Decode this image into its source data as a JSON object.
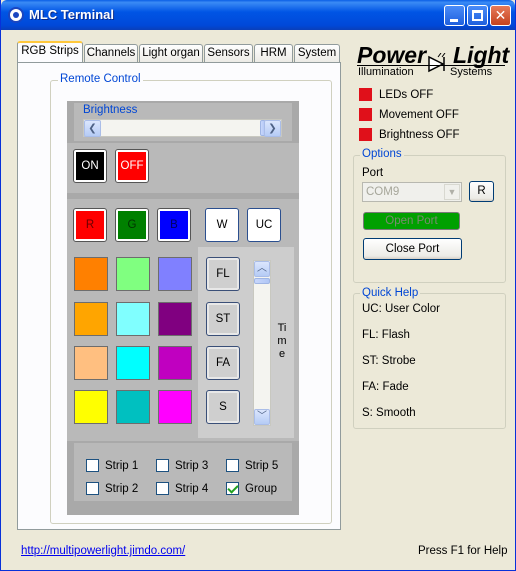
{
  "window": {
    "title": "MLC Terminal"
  },
  "tabs": [
    "RGB Strips",
    "Channels",
    "Light organ",
    "Sensors",
    "HRM",
    "System"
  ],
  "remote_control": {
    "label": "Remote Control",
    "brightness_label": "Brightness",
    "on_label": "ON",
    "off_label": "OFF",
    "rgb_buttons": [
      {
        "label": "R",
        "color": "#ff0000"
      },
      {
        "label": "G",
        "color": "#008000"
      },
      {
        "label": "B",
        "color": "#0000ff"
      }
    ],
    "w_label": "W",
    "uc_label": "UC",
    "palette": [
      [
        "#ff8000",
        "#80ff80",
        "#8080ff"
      ],
      [
        "#ffa500",
        "#80ffff",
        "#800080"
      ],
      [
        "#ffbf80",
        "#00ffff",
        "#c000c0"
      ],
      [
        "#ffff00",
        "#00c0c0",
        "#ff00ff"
      ]
    ],
    "effect_buttons": [
      "FL",
      "ST",
      "FA",
      "S"
    ],
    "time_label": "Time",
    "strips": [
      {
        "label": "Strip 1",
        "checked": false
      },
      {
        "label": "Strip 3",
        "checked": false
      },
      {
        "label": "Strip 5",
        "checked": false
      },
      {
        "label": "Strip 2",
        "checked": false
      },
      {
        "label": "Strip 4",
        "checked": false
      },
      {
        "label": "Group",
        "checked": true
      }
    ]
  },
  "logo": {
    "power": "Power",
    "light": "Light",
    "sub_left": "Illumination",
    "sub_right": "Systems"
  },
  "status": [
    "LEDs OFF",
    "Movement OFF",
    "Brightness OFF"
  ],
  "options": {
    "label": "Options",
    "port_label": "Port",
    "port_value": "COM9",
    "refresh_label": "R",
    "open_label": "Open Port",
    "close_label": "Close Port"
  },
  "quick_help": {
    "label": "Quick Help",
    "lines": [
      "UC: User Color",
      "FL: Flash",
      "ST: Strobe",
      "FA: Fade",
      "S: Smooth"
    ]
  },
  "footer": {
    "link": "http://multipowerlight.jimdo.com/",
    "hint": "Press F1 for Help"
  }
}
